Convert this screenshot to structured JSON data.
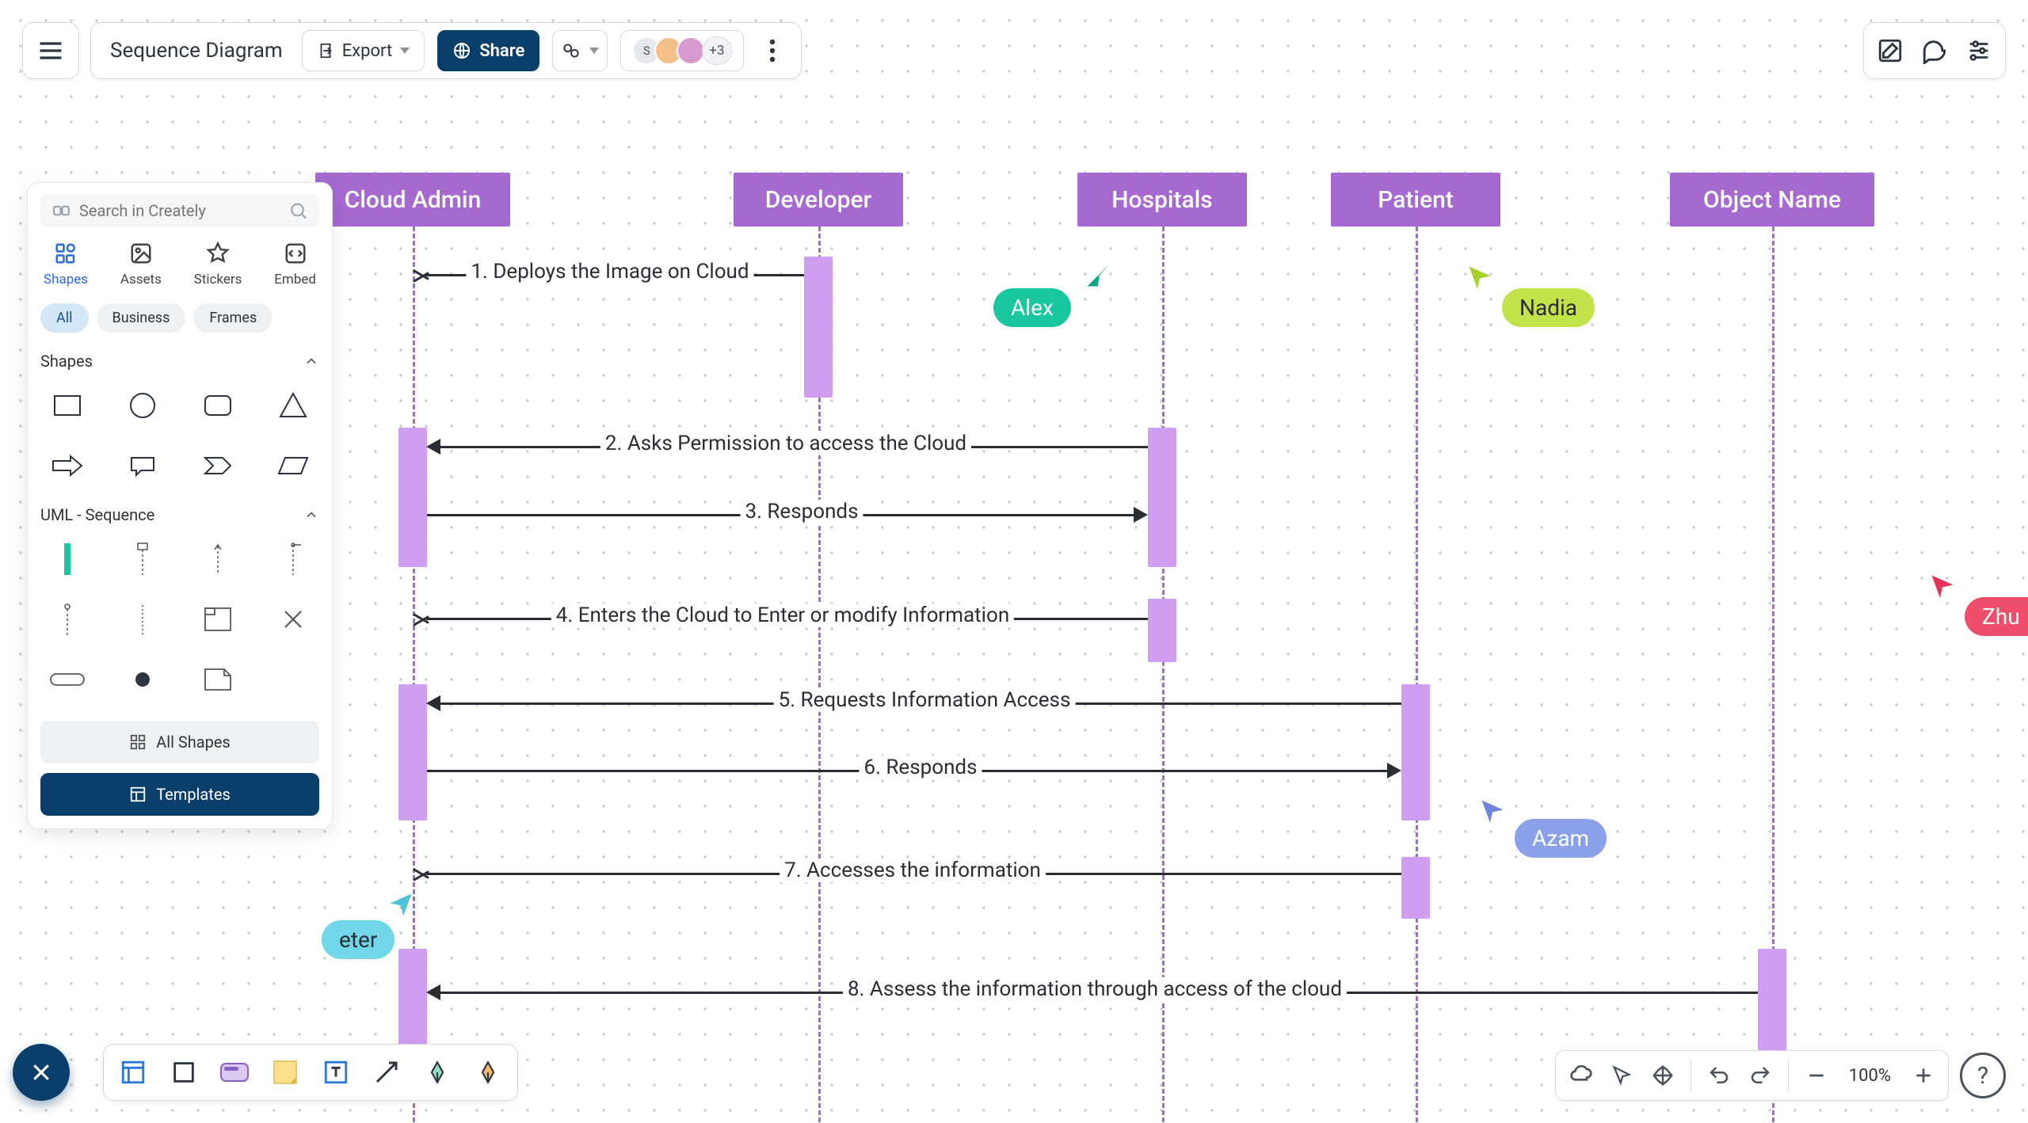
{
  "header": {
    "doc_title": "Sequence Diagram",
    "export_label": "Export",
    "share_label": "Share",
    "avatar_more": "+3",
    "avatar_initial": "S"
  },
  "search": {
    "placeholder": "Search in Creately"
  },
  "panel_tabs": {
    "shapes": "Shapes",
    "assets": "Assets",
    "stickers": "Stickers",
    "embed": "Embed"
  },
  "filters": {
    "all": "All",
    "business": "Business",
    "frames": "Frames"
  },
  "sections": {
    "shapes": "Shapes",
    "uml_seq": "UML - Sequence"
  },
  "panel_footer": {
    "all_shapes": "All Shapes",
    "templates": "Templates"
  },
  "zoom": {
    "value": "100%"
  },
  "diagram": {
    "actors": {
      "cloud_admin": "Cloud Admin",
      "developer": "Developer",
      "hospitals": "Hospitals",
      "patient": "Patient",
      "object_name": "Object Name"
    },
    "messages": {
      "m1": "1. Deploys the Image on Cloud",
      "m2": "2. Asks Permission to access the Cloud",
      "m3": "3. Responds",
      "m4": "4. Enters the Cloud to Enter or modify Information",
      "m5": "5. Requests Information Access",
      "m6": "6. Responds",
      "m7": "7. Accesses the information",
      "m8": "8. Assess the information through access of the cloud"
    }
  },
  "collaborators": {
    "alex": {
      "name": "Alex",
      "bg": "#18c6a0",
      "fg": "#ffffff",
      "cursor": "#0aa985"
    },
    "nadia": {
      "name": "Nadia",
      "bg": "#c2e24a",
      "fg": "#2a2e34",
      "cursor": "#a9cf2c"
    },
    "azam": {
      "name": "Azam",
      "bg": "#8aa0e8",
      "fg": "#ffffff",
      "cursor": "#6f86d8"
    },
    "peter": {
      "name": "eter",
      "bg": "#6fd7e8",
      "fg": "#2a2e34",
      "cursor": "#4fc3d6"
    },
    "zhu": {
      "name": "Zhu",
      "bg": "#ef4d6a",
      "fg": "#ffffff",
      "cursor": "#e23456"
    }
  },
  "colors": {
    "actor": "#a569d0",
    "activation": "#cf9ef0",
    "primary": "#0b3f6b"
  }
}
